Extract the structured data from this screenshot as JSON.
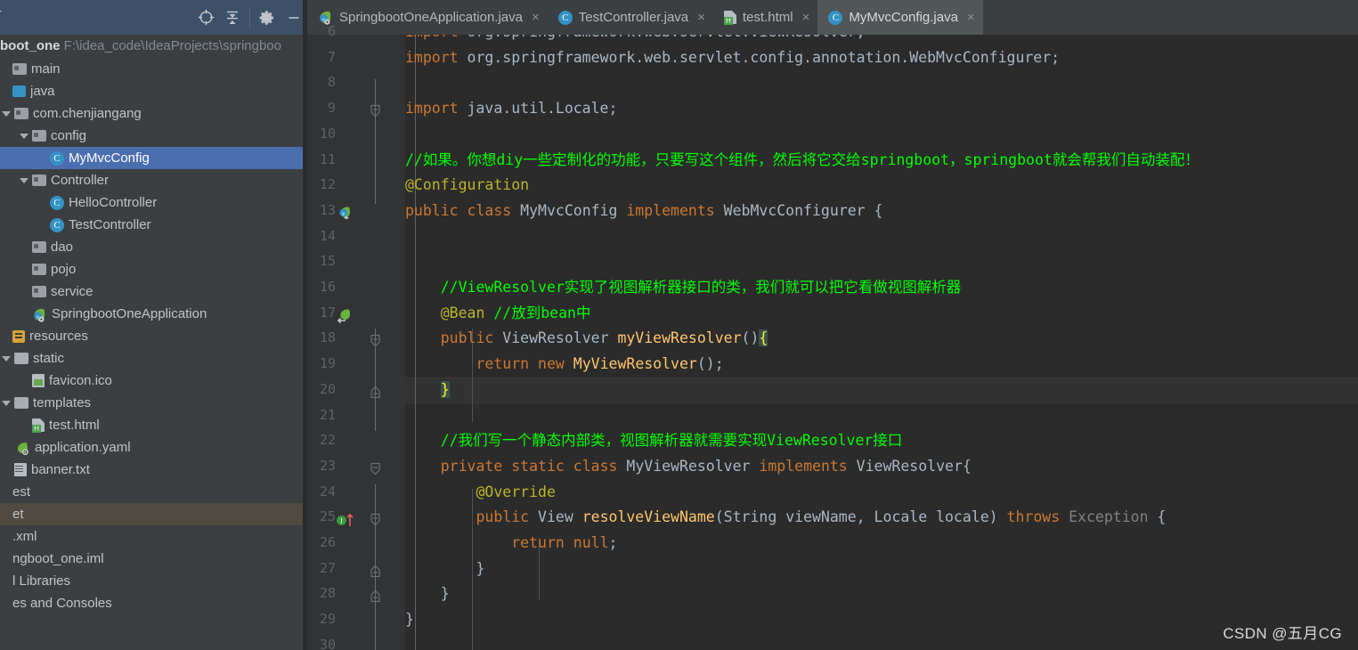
{
  "toolbar": {
    "locate_icon": "crosshair-target-icon",
    "collapse_icon": "collapse-all-icon",
    "settings_icon": "gear-icon",
    "minimize_icon": "minimize-icon",
    "dropdown_icon": "chevron-down-icon"
  },
  "project": {
    "name": "boot_one",
    "location": "F:\\idea_code\\IdeaProjects\\springboo",
    "clipped_row": "a"
  },
  "tree": {
    "items": [
      {
        "label": "main",
        "indent": 0,
        "icon": "folder-icon",
        "arrow": "none",
        "state": "normal"
      },
      {
        "label": "java",
        "indent": 0,
        "icon": "source-root-icon",
        "arrow": "none",
        "state": "normal"
      },
      {
        "label": "com.chenjiangang",
        "indent": 1,
        "icon": "package-icon",
        "arrow": "expanded",
        "state": "normal"
      },
      {
        "label": "config",
        "indent": 2,
        "icon": "package-icon",
        "arrow": "expanded",
        "state": "normal"
      },
      {
        "label": "MyMvcConfig",
        "indent": 3,
        "icon": "java-class-icon",
        "arrow": "none",
        "state": "selected"
      },
      {
        "label": "Controller",
        "indent": 2,
        "icon": "package-icon",
        "arrow": "expanded",
        "state": "normal"
      },
      {
        "label": "HelloController",
        "indent": 3,
        "icon": "java-class-icon",
        "arrow": "none",
        "state": "normal"
      },
      {
        "label": "TestController",
        "indent": 3,
        "icon": "java-class-icon",
        "arrow": "none",
        "state": "normal"
      },
      {
        "label": "dao",
        "indent": 2,
        "icon": "package-icon",
        "arrow": "none",
        "state": "normal"
      },
      {
        "label": "pojo",
        "indent": 2,
        "icon": "package-icon",
        "arrow": "none",
        "state": "normal"
      },
      {
        "label": "service",
        "indent": 2,
        "icon": "package-icon",
        "arrow": "none",
        "state": "normal"
      },
      {
        "label": "SpringbootOneApplication",
        "indent": 2,
        "icon": "spring-boot-icon",
        "arrow": "none",
        "state": "normal"
      },
      {
        "label": "resources",
        "indent": 0,
        "icon": "resource-root-icon",
        "arrow": "none",
        "state": "normal"
      },
      {
        "label": "static",
        "indent": 1,
        "icon": "folder-plain-icon",
        "arrow": "expanded",
        "state": "normal"
      },
      {
        "label": "favicon.ico",
        "indent": 2,
        "icon": "image-file-icon",
        "arrow": "none",
        "state": "normal"
      },
      {
        "label": "templates",
        "indent": 1,
        "icon": "folder-plain-icon",
        "arrow": "expanded",
        "state": "normal"
      },
      {
        "label": "test.html",
        "indent": 2,
        "icon": "html-file-icon",
        "arrow": "none",
        "state": "normal"
      },
      {
        "label": "application.yaml",
        "indent": 1,
        "icon": "yaml-spring-icon",
        "arrow": "none",
        "state": "normal"
      },
      {
        "label": "banner.txt",
        "indent": 1,
        "icon": "text-file-icon",
        "arrow": "none",
        "state": "normal"
      },
      {
        "label": "est",
        "indent": 0,
        "icon": "none",
        "arrow": "none",
        "state": "normal"
      },
      {
        "label": "et",
        "indent": 0,
        "icon": "none",
        "arrow": "none",
        "state": "highlight"
      },
      {
        "label": ".xml",
        "indent": 0,
        "icon": "none",
        "arrow": "none",
        "state": "normal"
      },
      {
        "label": "ngboot_one.iml",
        "indent": 0,
        "icon": "none",
        "arrow": "none",
        "state": "normal"
      },
      {
        "label": "l Libraries",
        "indent": 0,
        "icon": "none",
        "arrow": "none",
        "state": "normal"
      },
      {
        "label": "es and Consoles",
        "indent": 0,
        "icon": "none",
        "arrow": "none",
        "state": "normal"
      }
    ]
  },
  "editor": {
    "tabs": [
      {
        "label": "SpringbootOneApplication.java",
        "icon": "spring-boot-icon",
        "active": false,
        "close": "×"
      },
      {
        "label": "TestController.java",
        "icon": "java-class-icon",
        "active": false,
        "close": "×"
      },
      {
        "label": "test.html",
        "icon": "html-file-icon",
        "active": false,
        "close": "×"
      },
      {
        "label": "MyMvcConfig.java",
        "icon": "java-class-icon",
        "active": true,
        "close": "×"
      }
    ],
    "first_visible_line": 6,
    "caret_line": 20,
    "line_numbers": [
      "6",
      "7",
      "8",
      "9",
      "10",
      "11",
      "12",
      "13",
      "14",
      "15",
      "16",
      "17",
      "18",
      "19",
      "20",
      "21",
      "22",
      "23",
      "24",
      "25",
      "26",
      "27",
      "28",
      "29",
      "30"
    ],
    "gutter_icons": [
      {
        "line": 13,
        "icon": "spring-bean-class-icon"
      },
      {
        "line": 17,
        "icon": "spring-bean-method-icon"
      },
      {
        "line": 25,
        "icon": "implementing-method-icon"
      }
    ],
    "lines": [
      {
        "n": 6,
        "text": "import org.springframework.web.servlet.ViewResolver;"
      },
      {
        "n": 7,
        "text": "import org.springframework.web.servlet.config.annotation.WebMvcConfigurer;"
      },
      {
        "n": 8,
        "text": ""
      },
      {
        "n": 9,
        "text": "import java.util.Locale;"
      },
      {
        "n": 10,
        "text": ""
      },
      {
        "n": 11,
        "text": "//如果。你想diy一些定制化的功能，只要写这个组件，然后将它交给springboot，springboot就会帮我们自动装配！"
      },
      {
        "n": 12,
        "text": "@Configuration"
      },
      {
        "n": 13,
        "text": "public class MyMvcConfig implements WebMvcConfigurer {"
      },
      {
        "n": 14,
        "text": ""
      },
      {
        "n": 15,
        "text": ""
      },
      {
        "n": 16,
        "text": "    //ViewResolver实现了视图解析器接口的类，我们就可以把它看做视图解析器"
      },
      {
        "n": 17,
        "text": "    @Bean //放到bean中"
      },
      {
        "n": 18,
        "text": "    public ViewResolver myViewResolver(){"
      },
      {
        "n": 19,
        "text": "        return new MyViewResolver();"
      },
      {
        "n": 20,
        "text": "    }"
      },
      {
        "n": 21,
        "text": ""
      },
      {
        "n": 22,
        "text": "    //我们写一个静态内部类，视图解析器就需要实现ViewResolver接口"
      },
      {
        "n": 23,
        "text": "    private static class MyViewResolver implements ViewResolver{"
      },
      {
        "n": 24,
        "text": "        @Override"
      },
      {
        "n": 25,
        "text": "        public View resolveViewName(String viewName, Locale locale) throws Exception {"
      },
      {
        "n": 26,
        "text": "            return null;"
      },
      {
        "n": 27,
        "text": "        }"
      },
      {
        "n": 28,
        "text": "    }"
      },
      {
        "n": 29,
        "text": "}"
      },
      {
        "n": 30,
        "text": ""
      }
    ]
  },
  "watermark": {
    "text": "CSDN @五月CG"
  },
  "colors": {
    "editor_bg": "#2b2b2b",
    "gutter_bg": "#313335",
    "panel_bg": "#3c3f41",
    "header_bg": "#3c5068",
    "selection_blue": "#4b6eaf",
    "highlight_olive": "#4f4b41",
    "keyword_orange": "#cc7832",
    "annotation_yellow": "#bbb529",
    "comment_green": "#00ff00",
    "method_gold": "#ffc66d",
    "text_grey": "#a9b7c6",
    "caret_line": "#323232"
  }
}
